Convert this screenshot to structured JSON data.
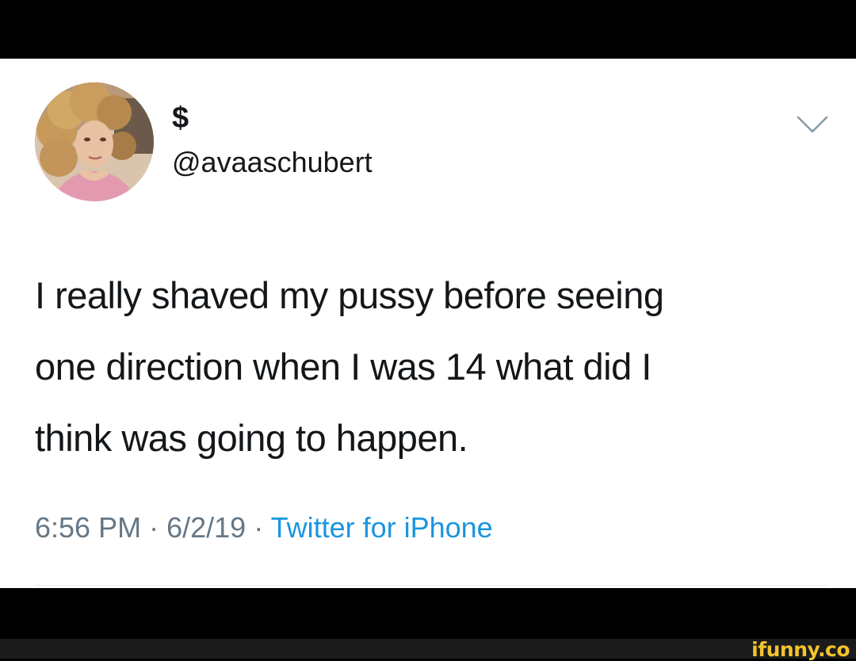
{
  "tweet": {
    "display_name": "$",
    "handle": "@avaaschubert",
    "text_lines": [
      "I really shaved my pussy before seeing",
      "one direction when I was 14 what did I",
      "think was going to happen."
    ],
    "time": "6:56 PM",
    "date": "6/2/19",
    "separator": "·",
    "source": "Twitter for iPhone"
  },
  "watermark": {
    "text": "ifunny.co"
  },
  "icons": {
    "avatar": "profile-photo",
    "menu": "chevron-down-icon"
  },
  "colors": {
    "text": "#14171a",
    "meta": "#657786",
    "link": "#1b95e0",
    "watermark": "#f3c32c"
  }
}
